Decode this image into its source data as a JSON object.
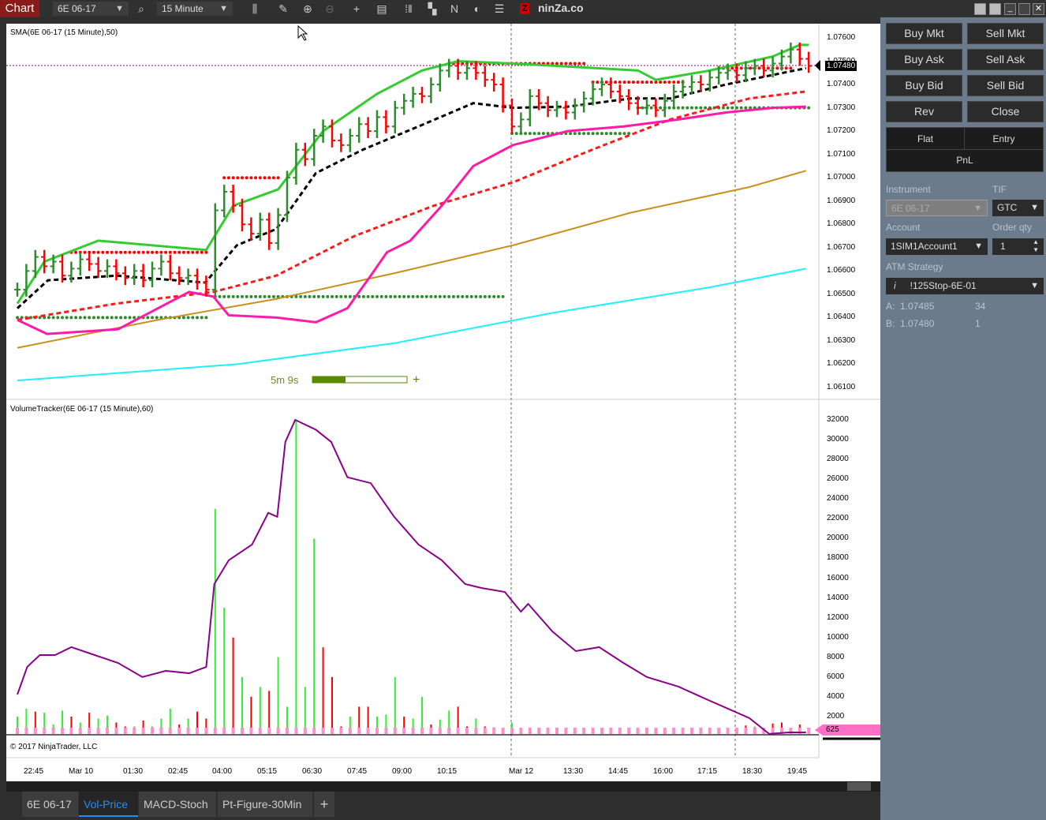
{
  "toolbar": {
    "chart_tab": "Chart",
    "instrument": "6E 06-17",
    "interval": "15 Minute",
    "brand": "ninZa.co",
    "brand_logo": "Z",
    "icons": [
      "search-icon",
      "bar-type-icon",
      "pencil-icon",
      "zoom-in-icon",
      "zoom-out-icon",
      "crosshair-icon",
      "data-box-icon",
      "properties-icon",
      "templates-icon",
      "strategy-icon",
      "refresh-icon",
      "list-icon"
    ]
  },
  "price_panel": {
    "indicator_label": "SMA(6E 06-17 (15 Minute),50)",
    "axis_ticks": [
      "1.07600",
      "1.07500",
      "1.07400",
      "1.07300",
      "1.07200",
      "1.07100",
      "1.07000",
      "1.06900",
      "1.06800",
      "1.06700",
      "1.06600",
      "1.06500",
      "1.06400",
      "1.06300",
      "1.06200",
      "1.06100"
    ],
    "current_price": "1.07480",
    "timer": "5m 9s",
    "timer_progress": 0.35
  },
  "volume_panel": {
    "indicator_label": "VolumeTracker(6E 06-17 (15 Minute),60)",
    "axis_ticks": [
      "32000",
      "30000",
      "28000",
      "26000",
      "24000",
      "22000",
      "20000",
      "18000",
      "16000",
      "14000",
      "12000",
      "10000",
      "8000",
      "6000",
      "4000",
      "2000"
    ],
    "current_value": "625",
    "copyright": "© 2017 NinjaTrader, LLC"
  },
  "time_axis": [
    "22:45",
    "Mar 10",
    "01:30",
    "02:45",
    "04:00",
    "05:15",
    "06:30",
    "07:45",
    "09:00",
    "10:15",
    "Mar 12",
    "13:30",
    "14:45",
    "16:00",
    "17:15",
    "18:30",
    "19:45"
  ],
  "tabs": [
    {
      "label": "6E 06-17"
    },
    {
      "label": "Vol-Price",
      "active": true
    },
    {
      "label": "MACD-Stoch"
    },
    {
      "label": "Pt-Figure-30Min"
    },
    {
      "label": "+"
    }
  ],
  "chart_trader": {
    "buttons": [
      "Buy Mkt",
      "Sell Mkt",
      "Buy Ask",
      "Sell Ask",
      "Buy Bid",
      "Sell Bid",
      "Rev",
      "Close"
    ],
    "flat": "Flat",
    "entry": "Entry",
    "pnl": "PnL",
    "instrument_label": "Instrument",
    "instrument": "6E 06-17",
    "tif_label": "TIF",
    "tif": "GTC",
    "account_label": "Account",
    "account": "1SIM1Account1",
    "qty_label": "Order qty",
    "qty": "1",
    "atm_label": "ATM Strategy",
    "atm_info": "i",
    "atm": "!125Stop-6E-01",
    "ask_label": "A:",
    "ask": "1.07485",
    "ask_size": "34",
    "bid_label": "B:",
    "bid": "1.07480",
    "bid_size": "1"
  },
  "chart_data": {
    "colors": {
      "upper": "#33cc33",
      "sma": "#000000",
      "red_dash": "#ff1a1a",
      "magenta": "#ff1aa8",
      "gold": "#c8911e",
      "cyan": "#1ef0ff",
      "volume_line": "#8b008b",
      "up": "#2e8b2e",
      "down": "#ff0000"
    },
    "upper_band": [
      [
        0,
        1.0646
      ],
      [
        3,
        1.0664
      ],
      [
        9,
        1.0673
      ],
      [
        21,
        1.0669
      ],
      [
        24,
        1.0688
      ],
      [
        29,
        1.0695
      ],
      [
        34,
        1.072
      ],
      [
        40,
        1.0736
      ],
      [
        45,
        1.0746
      ],
      [
        49,
        1.075
      ],
      [
        55,
        1.0749
      ],
      [
        60,
        1.0748
      ],
      [
        69,
        1.0746
      ],
      [
        71,
        1.0742
      ],
      [
        77,
        1.0746
      ],
      [
        84,
        1.0752
      ],
      [
        87,
        1.0757
      ],
      [
        88,
        1.0757
      ]
    ],
    "sma": [
      [
        0,
        1.0644
      ],
      [
        3.4,
        1.0656
      ],
      [
        11,
        1.0658
      ],
      [
        20.9,
        1.0655
      ],
      [
        24.4,
        1.0671
      ],
      [
        28.8,
        1.0678
      ],
      [
        33.2,
        1.0702
      ],
      [
        38.4,
        1.0712
      ],
      [
        44.6,
        1.0722
      ],
      [
        50.7,
        1.0732
      ],
      [
        55.1,
        1.073
      ],
      [
        61.2,
        1.07305
      ],
      [
        68.2,
        1.0734
      ],
      [
        72.6,
        1.0734
      ],
      [
        78.8,
        1.074
      ],
      [
        87.7,
        1.0747
      ]
    ],
    "red_dash": [
      [
        0,
        1.0639
      ],
      [
        11,
        1.0646
      ],
      [
        21.8,
        1.0651
      ],
      [
        28.8,
        1.0658
      ],
      [
        37.5,
        1.0675
      ],
      [
        46.3,
        1.0688
      ],
      [
        55.1,
        1.0698
      ],
      [
        63.9,
        1.0712
      ],
      [
        72.6,
        1.0725
      ],
      [
        81.4,
        1.0734
      ],
      [
        87.7,
        1.0737
      ]
    ],
    "magenta": [
      [
        0,
        1.0639
      ],
      [
        3.3,
        1.0633
      ],
      [
        11.2,
        1.0635
      ],
      [
        19.1,
        1.0651
      ],
      [
        21.8,
        1.0649
      ],
      [
        23.5,
        1.0641
      ],
      [
        28.8,
        1.064
      ],
      [
        33.2,
        1.0638
      ],
      [
        36.7,
        1.0644
      ],
      [
        39.3,
        1.0658
      ],
      [
        41.1,
        1.0668
      ],
      [
        43.7,
        1.0673
      ],
      [
        47.2,
        1.0688
      ],
      [
        50.7,
        1.0705
      ],
      [
        55.1,
        1.0714
      ],
      [
        61.2,
        1.072
      ],
      [
        67.4,
        1.0722
      ],
      [
        73.5,
        1.0725
      ],
      [
        78.8,
        1.0728
      ],
      [
        84,
        1.073
      ],
      [
        87.7,
        1.07305
      ]
    ],
    "gold": [
      [
        0,
        1.0627
      ],
      [
        15.6,
        1.0639
      ],
      [
        28.8,
        1.0648
      ],
      [
        41.9,
        1.0659
      ],
      [
        55.1,
        1.0671
      ],
      [
        68.2,
        1.0685
      ],
      [
        81.4,
        1.0696
      ],
      [
        87.7,
        1.0703
      ]
    ],
    "cyan": [
      [
        0,
        1.0613
      ],
      [
        24.4,
        1.062
      ],
      [
        41.9,
        1.0629
      ],
      [
        59.5,
        1.0642
      ],
      [
        77,
        1.0653
      ],
      [
        87.7,
        1.0661
      ]
    ],
    "closes": [
      1.0652,
      1.066,
      1.0666,
      1.0662,
      1.0664,
      1.0658,
      1.0661,
      1.0665,
      1.0663,
      1.066,
      1.0662,
      1.0659,
      1.0657,
      1.066,
      1.0656,
      1.0661,
      1.0664,
      1.0659,
      1.0657,
      1.0658,
      1.0655,
      1.0652,
      1.0686,
      1.0694,
      1.0688,
      1.068,
      1.0676,
      1.0682,
      1.0672,
      1.0684,
      1.07,
      1.0712,
      1.0708,
      1.0718,
      1.0722,
      1.0716,
      1.0714,
      1.0718,
      1.0723,
      1.072,
      1.0726,
      1.0722,
      1.073,
      1.0733,
      1.0736,
      1.0735,
      1.074,
      1.0746,
      1.0748,
      1.0745,
      1.0747,
      1.0745,
      1.0742,
      1.074,
      1.0731,
      1.0722,
      1.0725,
      1.0735,
      1.0732,
      1.0729,
      1.073,
      1.0728,
      1.0731,
      1.0734,
      1.0738,
      1.074,
      1.0737,
      1.0735,
      1.0732,
      1.073,
      1.0731,
      1.0729,
      1.0733,
      1.0737,
      1.0739,
      1.0741,
      1.074,
      1.0743,
      1.0745,
      1.0746,
      1.0744,
      1.0747,
      1.0748,
      1.0746,
      1.0749,
      1.0752,
      1.0755,
      1.0751,
      1.0748
    ],
    "stops": [
      {
        "price": 1.0668,
        "from": 6,
        "to": 21,
        "color": "red"
      },
      {
        "price": 1.07,
        "from": 23,
        "to": 29,
        "color": "red"
      },
      {
        "price": 1.0749,
        "from": 48,
        "to": 63,
        "color": "red"
      },
      {
        "price": 1.0741,
        "from": 64,
        "to": 74,
        "color": "red"
      },
      {
        "price": 1.0747,
        "from": 78,
        "to": 86,
        "color": "red"
      },
      {
        "price": 1.064,
        "from": 0,
        "to": 21,
        "color": "green"
      },
      {
        "price": 1.0649,
        "from": 22,
        "to": 54,
        "color": "green"
      },
      {
        "price": 1.0719,
        "from": 55,
        "to": 68,
        "color": "green"
      },
      {
        "price": 1.073,
        "from": 69,
        "to": 88,
        "color": "green"
      }
    ],
    "volumes": [
      2000,
      2800,
      2500,
      2400,
      1200,
      2600,
      2000,
      1400,
      2400,
      1800,
      2100,
      1400,
      1000,
      1000,
      1600,
      1000,
      1800,
      2800,
      1200,
      1800,
      2500,
      1800,
      23000,
      13000,
      10000,
      6000,
      4000,
      5000,
      4600,
      8000,
      3000,
      32000,
      5000,
      20000,
      9000,
      6000,
      1000,
      2000,
      3000,
      3000,
      2000,
      2200,
      6000,
      2000,
      1800,
      4000,
      1200,
      1700,
      2600,
      3000,
      1000,
      1800,
      1000,
      900,
      800,
      1400,
      600,
      600,
      500,
      600,
      500,
      500,
      400,
      600,
      500,
      500,
      500,
      500,
      600,
      500,
      500,
      500,
      500,
      400,
      500,
      500,
      400,
      500,
      500,
      500,
      500,
      1100,
      1000,
      700,
      1300,
      1400,
      800,
      1200,
      700
    ],
    "vol_colors": "GGRGGGRGRGGRRGRGGGRGRRGGRGRGRGGGGGRRRGRRGGGRGGRGGRRGRRRGGGRGGGGGGGGGGGGGGGRGGGGGGRGGRRGRR",
    "volume_line": [
      [
        0,
        4230
      ],
      [
        1.1,
        7030
      ],
      [
        2.5,
        8220
      ],
      [
        4.2,
        8220
      ],
      [
        6.0,
        9020
      ],
      [
        8.6,
        8220
      ],
      [
        11.2,
        7420
      ],
      [
        13.9,
        6000
      ],
      [
        16.5,
        6620
      ],
      [
        19.1,
        6380
      ],
      [
        21,
        7010
      ],
      [
        21.9,
        15400
      ],
      [
        23.5,
        17800
      ],
      [
        26.1,
        19400
      ],
      [
        27.9,
        22600
      ],
      [
        28.9,
        22200
      ],
      [
        29.8,
        29770
      ],
      [
        30.9,
        32000
      ],
      [
        33.2,
        31000
      ],
      [
        34.9,
        29770
      ],
      [
        36.7,
        26200
      ],
      [
        39.3,
        25600
      ],
      [
        41.9,
        22200
      ],
      [
        44.6,
        19400
      ],
      [
        47.2,
        17800
      ],
      [
        49.8,
        15400
      ],
      [
        51.6,
        15000
      ],
      [
        54.2,
        14600
      ],
      [
        56,
        12600
      ],
      [
        56.8,
        13400
      ],
      [
        59.5,
        10600
      ],
      [
        62.1,
        8620
      ],
      [
        64.7,
        9020
      ],
      [
        67.4,
        7420
      ],
      [
        70,
        6000
      ],
      [
        73.5,
        5030
      ],
      [
        77,
        3600
      ],
      [
        81.4,
        1850
      ],
      [
        83.6,
        250
      ],
      [
        85.8,
        400
      ],
      [
        87.7,
        400
      ]
    ]
  }
}
